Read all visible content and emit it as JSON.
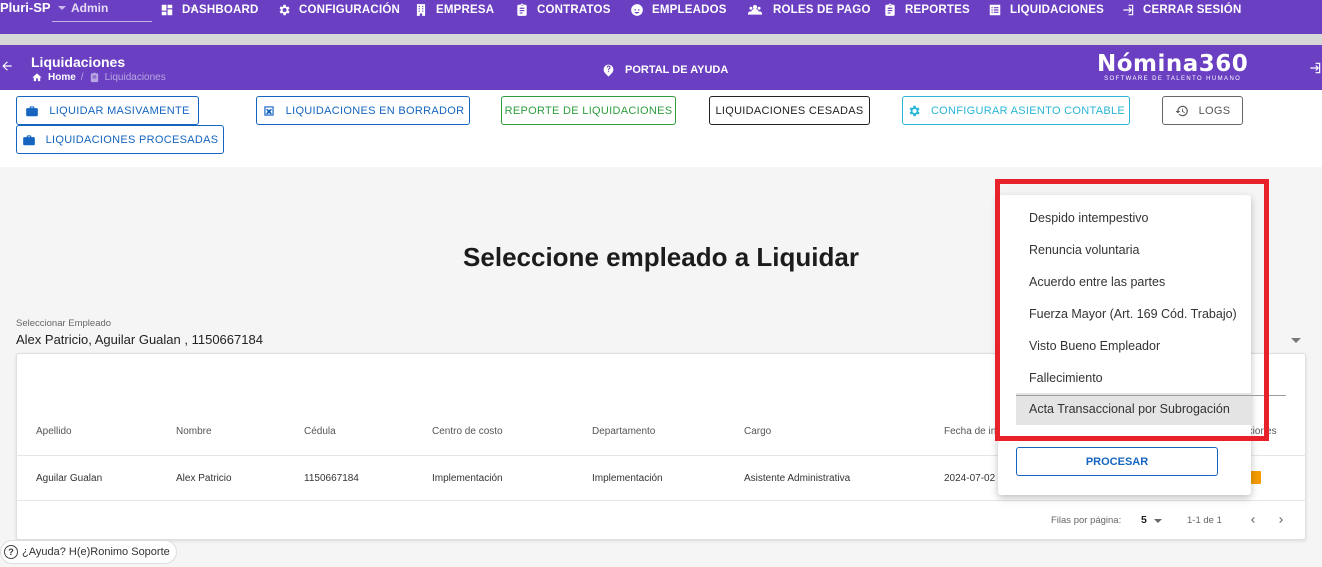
{
  "topnav": {
    "brand": "Pluri-SP",
    "role": "Admin",
    "items": [
      {
        "label": "DASHBOARD",
        "icon": "dashboard-icon"
      },
      {
        "label": "CONFIGURACIÓN",
        "icon": "gear-icon"
      },
      {
        "label": "EMPRESA",
        "icon": "building-icon"
      },
      {
        "label": "CONTRATOS",
        "icon": "clipboard-icon"
      },
      {
        "label": "EMPLEADOS",
        "icon": "face-icon"
      },
      {
        "label": "ROLES DE PAGO",
        "icon": "users-icon"
      },
      {
        "label": "REPORTES",
        "icon": "report-icon"
      },
      {
        "label": "LIQUIDACIONES",
        "icon": "list-icon"
      },
      {
        "label": "CERRAR SESIÓN",
        "icon": "logout-icon"
      }
    ]
  },
  "header": {
    "title": "Liquidaciones",
    "breadcrumb_home": "Home",
    "breadcrumb_sep": "/",
    "breadcrumb_current": "Liquidaciones",
    "help": "PORTAL DE AYUDA",
    "logo_main": "Nómina360",
    "logo_sub": "SOFTWARE DE TALENTO HUMANO"
  },
  "actions": {
    "liquidar_masivamente": "LIQUIDAR MASIVAMENTE",
    "liquidaciones_borrador": "LIQUIDACIONES EN BORRADOR",
    "reporte": "REPORTE DE LIQUIDACIONES",
    "cesadas": "LIQUIDACIONES CESADAS",
    "asiento": "CONFIGURAR ASIENTO CONTABLE",
    "logs": "LOGS",
    "procesadas": "LIQUIDACIONES PROCESADAS"
  },
  "main": {
    "heading": "Seleccione empleado a Liquidar",
    "select_label": "Seleccionar Empleado",
    "select_value": "Alex Patricio, Aguilar Gualan , 1150667184"
  },
  "table": {
    "headers": [
      "Apellido",
      "Nombre",
      "Cédula",
      "Centro de costo",
      "Departamento",
      "Cargo",
      "Fecha de in",
      "Acciones"
    ],
    "rows": [
      [
        "Aguilar Gualan",
        "Alex Patricio",
        "1150667184",
        "Implementación",
        "Implementación",
        "Asistente Administrativa",
        "2024-07-02"
      ]
    ],
    "rows_per_page_label": "Filas por página:",
    "rows_per_page": "5",
    "range": "1-1 de 1"
  },
  "menu": {
    "options": [
      "Despido intempestivo",
      "Renuncia voluntaria",
      "Acuerdo entre las partes",
      "Fuerza Mayor (Art. 169 Cód. Trabajo)",
      "Visto Bueno Empleador",
      "Fallecimiento",
      "Acta Transaccional por Subrogación"
    ],
    "selected_index": 6,
    "procesar": "PROCESAR"
  },
  "support": {
    "label": "¿Ayuda? H(e)Ronimo Soporte"
  },
  "colors": {
    "primary": "#6a3fc1",
    "blue": "#1565c0",
    "green": "#2e9e3e",
    "cyan": "#29b6d6",
    "red_highlight": "#e8222a",
    "orange": "#f59b00"
  }
}
